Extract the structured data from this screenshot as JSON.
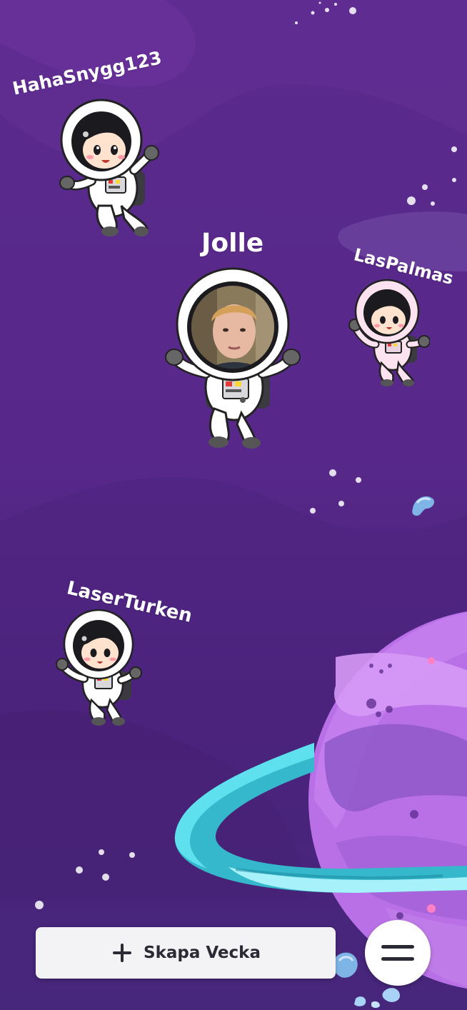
{
  "players": [
    {
      "name": "HahaSnygg123",
      "avatar": "astronaut-girl-icon"
    },
    {
      "name": "Jolle",
      "avatar": "astronaut-photo-icon"
    },
    {
      "name": "LasPalmas",
      "avatar": "astronaut-girl-pink-icon"
    },
    {
      "name": "LaserTurken",
      "avatar": "astronaut-girl-icon"
    }
  ],
  "create_week": {
    "label": "Skapa Vecka",
    "icon": "plus-icon"
  },
  "menu": {
    "icon": "hamburger-menu-icon"
  },
  "colors": {
    "background": "#5a2b8c",
    "planet": "#b46be0",
    "ring": "#4dd3e6",
    "button_bg": "#f3f3f5",
    "button_text": "#2a2a35"
  }
}
